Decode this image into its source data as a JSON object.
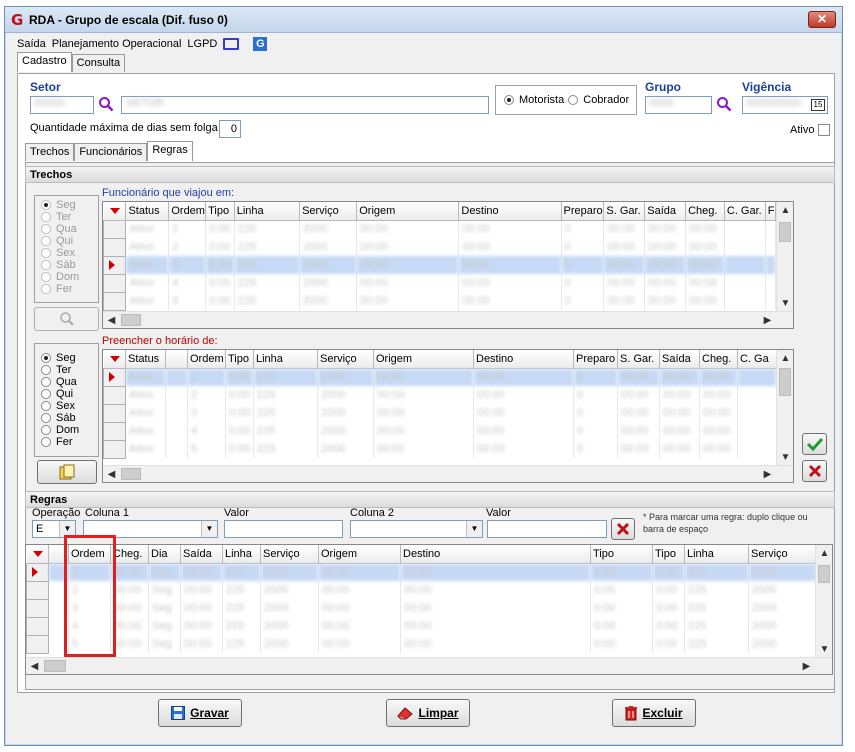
{
  "window": {
    "title": "RDA - Grupo de escala (Dif. fuso 0)",
    "logo": "G",
    "close": "✕"
  },
  "menu": {
    "items": [
      "Saída",
      "Planejamento Operacional",
      "LGPD"
    ]
  },
  "main_tabs": [
    "Cadastro",
    "Consulta"
  ],
  "setor": {
    "label": "Setor",
    "code": "00000",
    "desc": "SETOR"
  },
  "tipo": {
    "options": [
      "Motorista",
      "Cobrador"
    ],
    "selected": "Motorista"
  },
  "grupo": {
    "label": "Grupo",
    "value": "0000"
  },
  "vigencia": {
    "label": "Vigência",
    "value": "00/00/0000"
  },
  "folga": {
    "label": "Quantidade máxima de dias sem folga",
    "value": "0"
  },
  "ativo": {
    "label": "Ativo"
  },
  "sub_tabs": [
    "Trechos",
    "Funcionários",
    "Regras"
  ],
  "trechos": {
    "header": "Trechos",
    "days": [
      "Seg",
      "Ter",
      "Qua",
      "Qui",
      "Sex",
      "Sáb",
      "Dom",
      "Fer"
    ],
    "grid1_caption": "Funcionário que viajou em:",
    "grid1_columns": [
      "Status",
      "Ordem",
      "Tipo",
      "Linha",
      "Serviço",
      "Origem",
      "Destino",
      "Preparo",
      "S. Gar.",
      "Saída",
      "Cheg.",
      "C. Gar.",
      "F"
    ],
    "grid1_rows": [
      [
        "Ativo",
        "1",
        "0:00",
        "225",
        "2000",
        "00:00",
        "00:00",
        "0",
        "00:00",
        "00:00",
        "00:00",
        "",
        ""
      ],
      [
        "Ativo",
        "2",
        "0:00",
        "225",
        "2000",
        "00:00",
        "00:00",
        "0",
        "00:00",
        "00:00",
        "00:00",
        "",
        ""
      ],
      [
        "Ativo",
        "3",
        "0:00",
        "225",
        "2000",
        "00:00",
        "00:00",
        "0",
        "00:00",
        "00:00",
        "00:00",
        "",
        ""
      ],
      [
        "Ativo",
        "4",
        "0:00",
        "225",
        "2000",
        "00:00",
        "00:00",
        "0",
        "00:00",
        "00:00",
        "00:00",
        "",
        ""
      ],
      [
        "Ativo",
        "5",
        "0:00",
        "225",
        "2000",
        "00:00",
        "00:00",
        "0",
        "00:00",
        "00:00",
        "00:00",
        "",
        ""
      ]
    ],
    "grid2_caption": "Preencher o horário de:",
    "grid2_columns": [
      "Status",
      "",
      "Ordem",
      "Tipo",
      "Linha",
      "Serviço",
      "Origem",
      "Destino",
      "Preparo",
      "S. Gar.",
      "Saída",
      "Cheg.",
      "C. Ga"
    ],
    "grid2_rows": [
      [
        "Ativo",
        "",
        "1",
        "0:00",
        "225",
        "2000",
        "00:00",
        "00:00",
        "0",
        "00:00",
        "00:00",
        "00:00",
        ""
      ],
      [
        "Ativo",
        "",
        "2",
        "0:00",
        "225",
        "2000",
        "00:00",
        "00:00",
        "0",
        "00:00",
        "00:00",
        "00:00",
        ""
      ],
      [
        "Ativo",
        "",
        "3",
        "0:00",
        "225",
        "2000",
        "00:00",
        "00:00",
        "0",
        "00:00",
        "00:00",
        "00:00",
        ""
      ],
      [
        "Ativo",
        "",
        "4",
        "0:00",
        "225",
        "2000",
        "00:00",
        "00:00",
        "0",
        "00:00",
        "00:00",
        "00:00",
        ""
      ],
      [
        "Ativo",
        "",
        "5",
        "0:00",
        "225",
        "2000",
        "00:00",
        "00:00",
        "0",
        "00:00",
        "00:00",
        "00:00",
        ""
      ]
    ]
  },
  "regras": {
    "header": "Regras",
    "operacao_label": "Operação",
    "coluna1_label": "Coluna 1",
    "valor1_label": "Valor",
    "coluna2_label": "Coluna 2",
    "valor2_label": "Valor",
    "operacao_value": "E",
    "hint": "* Para marcar uma regra: duplo clique ou barra de espaço",
    "columns": [
      "Ordem",
      "Cheg.",
      "Dia",
      "Saída",
      "Linha",
      "Serviço",
      "Origem",
      "Destino",
      "Tipo",
      "Tipo",
      "Linha",
      "Serviço"
    ],
    "rows": [
      [
        "1",
        "00:00",
        "Seg",
        "00:00",
        "225",
        "2000",
        "00:00",
        "00:00",
        "0:00",
        "0:00",
        "225",
        "2000"
      ],
      [
        "2",
        "00:00",
        "Seg",
        "00:00",
        "225",
        "2000",
        "00:00",
        "00:00",
        "0:00",
        "0:00",
        "225",
        "2000"
      ],
      [
        "3",
        "00:00",
        "Seg",
        "00:00",
        "225",
        "2000",
        "00:00",
        "00:00",
        "0:00",
        "0:00",
        "225",
        "2000"
      ],
      [
        "4",
        "00:00",
        "Seg",
        "00:00",
        "225",
        "2000",
        "00:00",
        "00:00",
        "0:00",
        "0:00",
        "225",
        "2000"
      ],
      [
        "5",
        "00:00",
        "Seg",
        "00:00",
        "225",
        "2000",
        "00:00",
        "00:00",
        "0:00",
        "0:00",
        "225",
        "2000"
      ]
    ]
  },
  "buttons": {
    "gravar": "Gravar",
    "limpar": "Limpar",
    "excluir": "Excluir"
  },
  "colors": {
    "accent": "#1a3f9c",
    "highlight": "#e02020",
    "selection": "#c6d9f5"
  }
}
